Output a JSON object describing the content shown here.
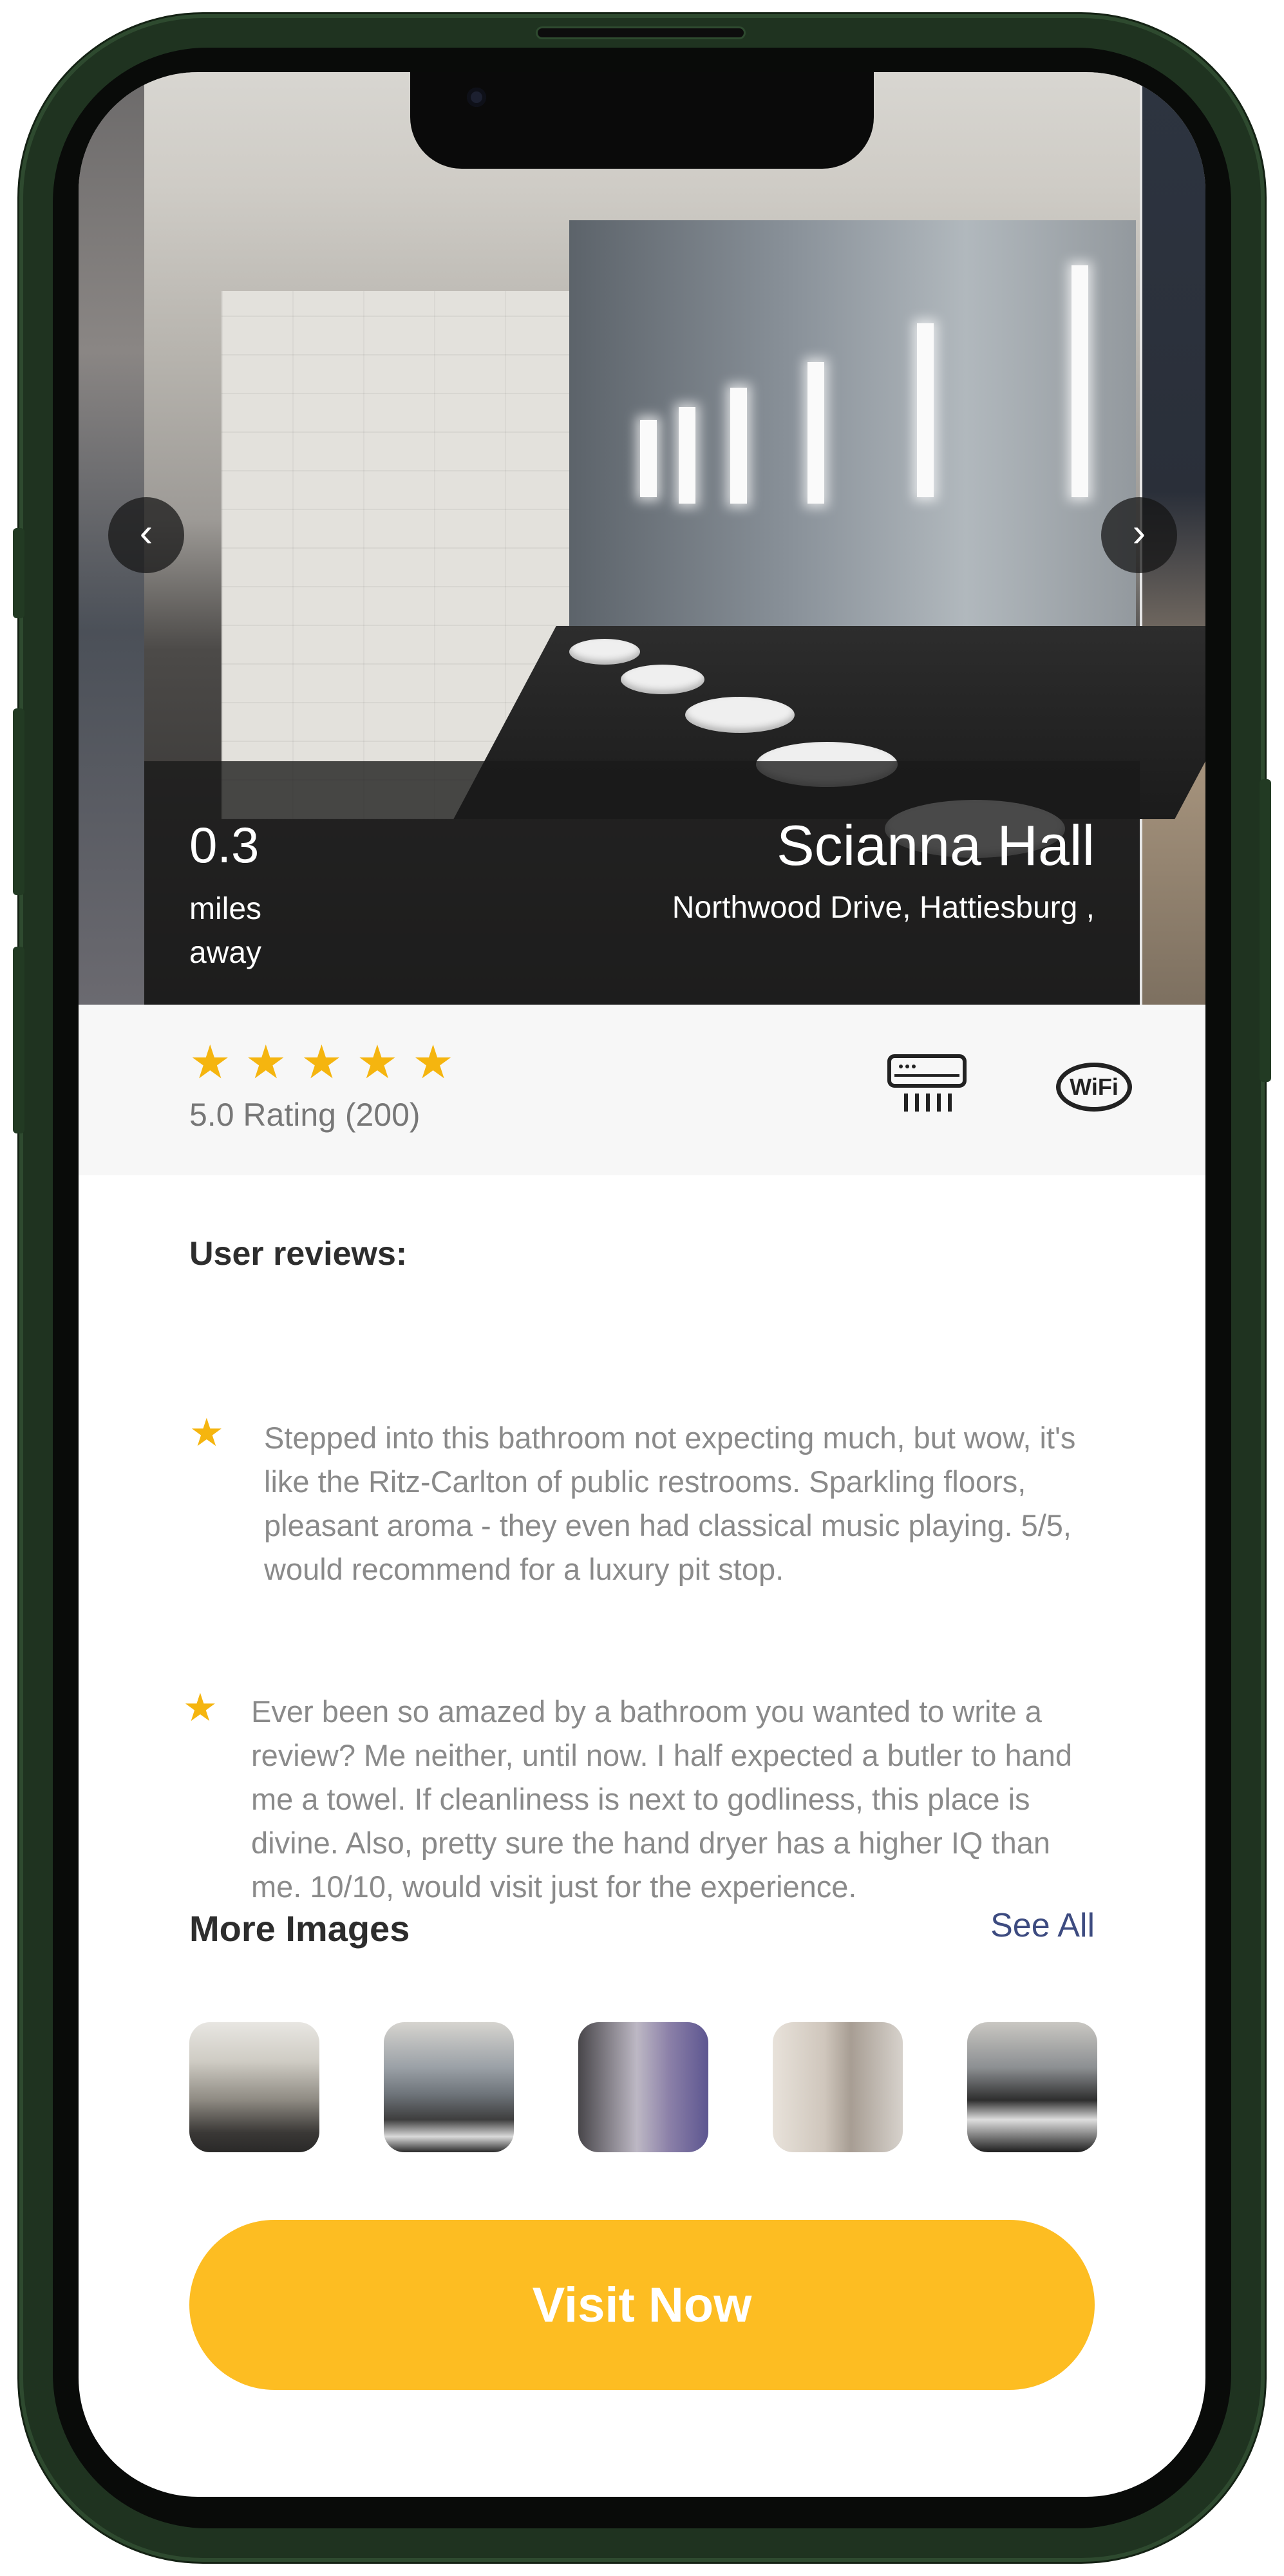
{
  "hero": {
    "distance_value": "0.3",
    "distance_unit": "miles away",
    "name": "Scianna Hall",
    "address": "Northwood Drive, Hattiesburg ,",
    "prev_icon": "chevron-left-icon",
    "next_icon": "chevron-right-icon"
  },
  "rating": {
    "stars": 5,
    "text": "5.0 Rating (200)",
    "star_color": "#f5b50f"
  },
  "amenities": [
    {
      "name": "air-conditioner-icon"
    },
    {
      "name": "wifi-icon",
      "label": "WiFi"
    }
  ],
  "reviews": {
    "title": "User reviews:",
    "items": [
      {
        "text": "Stepped into this bathroom not expecting much, but wow, it's like the Ritz-Carlton of public restrooms. Sparkling floors, pleasant aroma - they even had classical music playing. 5/5, would recommend for a luxury pit stop."
      },
      {
        "text": "Ever been so amazed by a bathroom you wanted to write a review? Me neither, until now. I half expected a butler to hand me a towel. If cleanliness is next to godliness, this place is divine. Also, pretty sure the hand dryer has a higher IQ than me. 10/10, would visit just for the experience."
      }
    ]
  },
  "more_images": {
    "title": "More Images",
    "see_all": "See All",
    "count": 5
  },
  "cta": {
    "label": "Visit Now",
    "color": "#fdbd22"
  }
}
